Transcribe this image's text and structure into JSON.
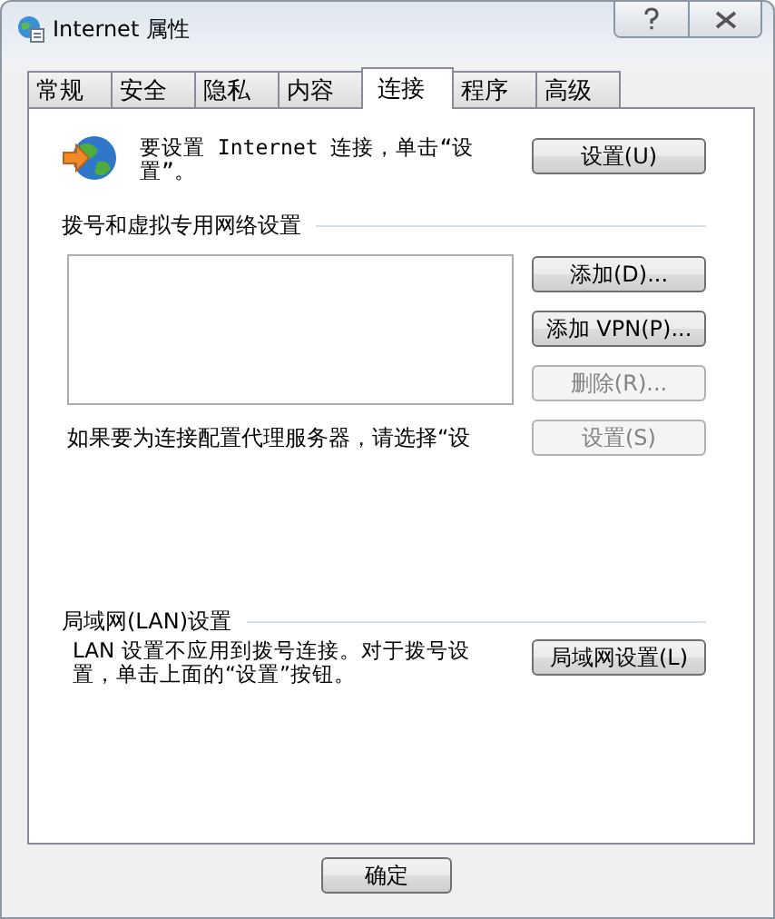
{
  "window": {
    "title": "Internet 属性"
  },
  "tabs": [
    {
      "label": "常规",
      "selected": false
    },
    {
      "label": "安全",
      "selected": false
    },
    {
      "label": "隐私",
      "selected": false
    },
    {
      "label": "内容",
      "selected": false
    },
    {
      "label": "连接",
      "selected": true
    },
    {
      "label": "程序",
      "selected": false
    },
    {
      "label": "高级",
      "selected": false
    }
  ],
  "setup": {
    "text": "要设置 Internet 连接，单击“设置”。",
    "button": {
      "label": "设置(U)",
      "disabled": false
    }
  },
  "dialup": {
    "heading": "拨号和虚拟专用网络设置",
    "buttons": [
      {
        "label": "添加(D)...",
        "disabled": false
      },
      {
        "label": "添加 VPN(P)...",
        "disabled": false
      },
      {
        "label": "删除(R)...",
        "disabled": true
      },
      {
        "label": "设置(S)",
        "disabled": true
      }
    ],
    "proxy_text": "如果要为连接配置代理服务器，请选择“设"
  },
  "lan": {
    "heading": "局域网(LAN)设置",
    "text": "LAN 设置不应用到拨号连接。对于拨号设置，单击上面的“设置”按钮。",
    "button": {
      "label": "局域网设置(L)",
      "disabled": false
    }
  },
  "footer_buttons": [
    {
      "label": "确定",
      "disabled": false
    }
  ]
}
